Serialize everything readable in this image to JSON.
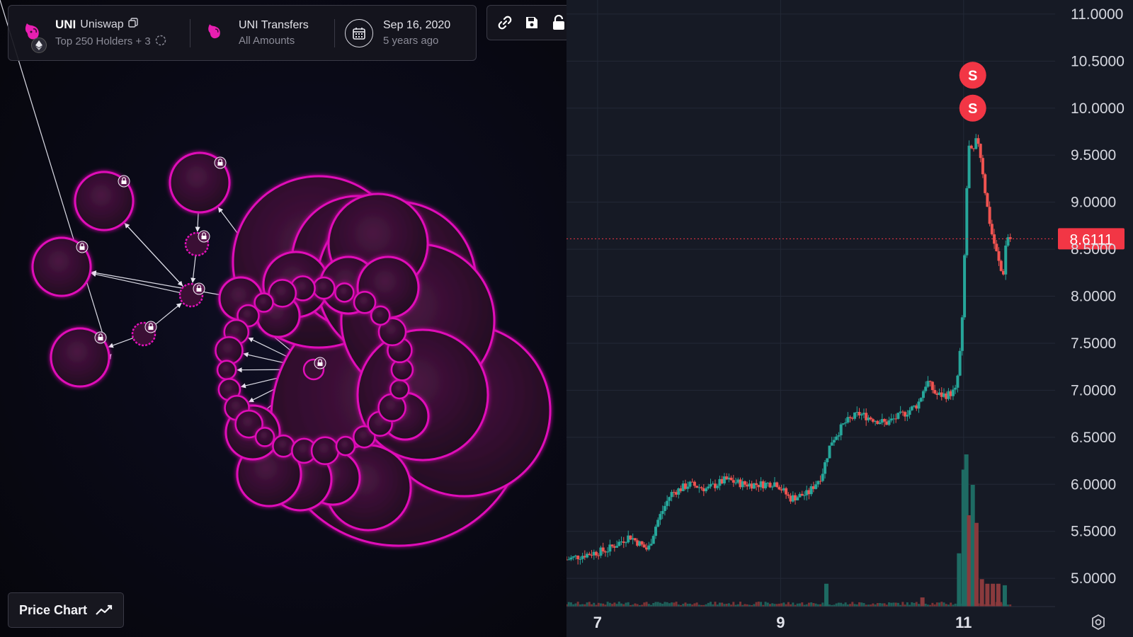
{
  "header": {
    "token_symbol": "UNI",
    "token_name": "Uniswap",
    "holders_filter": "Top 250 Holders + 3",
    "transfers_title": "UNI Transfers",
    "transfers_sub": "All Amounts",
    "date": "Sep 16, 2020",
    "date_relative": "5 years ago"
  },
  "toolbar": {
    "items": [
      "link-icon",
      "save-icon",
      "lock-icon"
    ]
  },
  "price_chart_button": {
    "label": "Price Chart"
  },
  "colors": {
    "bubble_stroke": "#e010b8",
    "bubble_fill_dark": "#200a1e",
    "bubble_fill_light": "#4a1442",
    "up_candle": "#26a69a",
    "down_candle": "#ef5350",
    "price_tag": "#f23645",
    "marker": "#f23645",
    "chart_bg": "#161a25",
    "grid": "#232836"
  },
  "chart_data": {
    "type": "candlestick",
    "y_ticks": [
      "5.0000",
      "5.5000",
      "6.0000",
      "6.5000",
      "7.0000",
      "7.5000",
      "8.0000",
      "8.5000",
      "9.0000",
      "9.5000",
      "10.0000",
      "10.5000",
      "11.0000"
    ],
    "ylim": [
      4.7,
      11.15
    ],
    "x_ticks": [
      {
        "label": "7",
        "t": 7
      },
      {
        "label": "9",
        "t": 9
      },
      {
        "label": "11",
        "t": 11
      }
    ],
    "xlim": [
      6.66,
      12.0
    ],
    "current_price": "8.6111",
    "current_price_value": 8.6111,
    "markers": [
      {
        "label": "S",
        "t": 11.1,
        "price": 10.35
      },
      {
        "label": "S",
        "t": 11.1,
        "price": 10.0
      }
    ],
    "price_path": [
      [
        6.66,
        5.2
      ],
      [
        6.85,
        5.25
      ],
      [
        7.1,
        5.3
      ],
      [
        7.35,
        5.45
      ],
      [
        7.55,
        5.3
      ],
      [
        7.65,
        5.6
      ],
      [
        7.8,
        5.9
      ],
      [
        8.0,
        6.0
      ],
      [
        8.2,
        5.95
      ],
      [
        8.4,
        6.05
      ],
      [
        8.6,
        6.0
      ],
      [
        8.8,
        6.0
      ],
      [
        8.95,
        6.02
      ],
      [
        9.1,
        5.85
      ],
      [
        9.3,
        5.9
      ],
      [
        9.45,
        6.1
      ],
      [
        9.55,
        6.45
      ],
      [
        9.7,
        6.65
      ],
      [
        9.85,
        6.75
      ],
      [
        10.0,
        6.7
      ],
      [
        10.15,
        6.65
      ],
      [
        10.35,
        6.75
      ],
      [
        10.5,
        6.85
      ],
      [
        10.6,
        7.1
      ],
      [
        10.7,
        6.95
      ],
      [
        10.82,
        6.95
      ],
      [
        10.92,
        7.0
      ],
      [
        10.98,
        7.6
      ],
      [
        11.02,
        8.7
      ],
      [
        11.05,
        9.6
      ],
      [
        11.1,
        9.5
      ],
      [
        11.15,
        9.7
      ],
      [
        11.2,
        9.4
      ],
      [
        11.25,
        9.0
      ],
      [
        11.3,
        8.7
      ],
      [
        11.35,
        8.5
      ],
      [
        11.4,
        8.3
      ],
      [
        11.43,
        8.2
      ],
      [
        11.47,
        8.65
      ],
      [
        11.52,
        8.6
      ]
    ],
    "volume_spikes": [
      {
        "t": 9.5,
        "v": 0.15,
        "up": true
      },
      {
        "t": 10.55,
        "v": 0.06,
        "up": false
      },
      {
        "t": 10.95,
        "v": 0.35,
        "up": true
      },
      {
        "t": 11.0,
        "v": 0.9,
        "up": true
      },
      {
        "t": 11.03,
        "v": 1.0,
        "up": true
      },
      {
        "t": 11.06,
        "v": 0.6,
        "up": false
      },
      {
        "t": 11.1,
        "v": 0.8,
        "up": true
      },
      {
        "t": 11.14,
        "v": 0.55,
        "up": false
      },
      {
        "t": 11.2,
        "v": 0.18,
        "up": false
      },
      {
        "t": 11.26,
        "v": 0.15,
        "up": false
      },
      {
        "t": 11.32,
        "v": 0.15,
        "up": false
      },
      {
        "t": 11.38,
        "v": 0.15,
        "up": false
      },
      {
        "t": 11.45,
        "v": 0.14,
        "up": true
      }
    ]
  }
}
